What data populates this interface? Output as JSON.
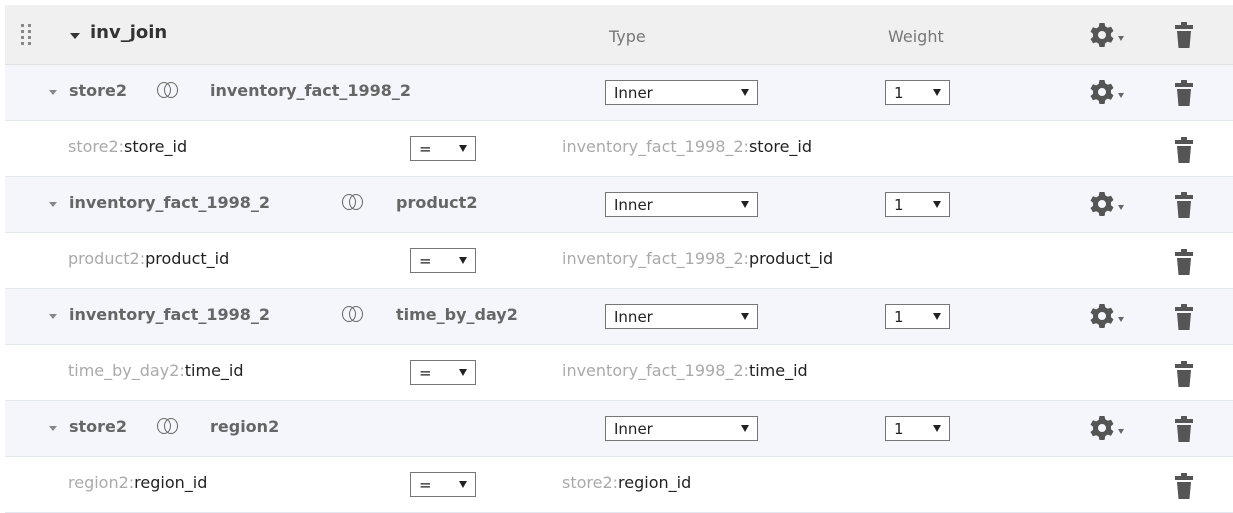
{
  "header": {
    "title": "inv_join",
    "type_label": "Type",
    "weight_label": "Weight",
    "gear_icon": "gear-icon",
    "trash_icon": "trash-icon",
    "drag_icon": "drag-handle-icon"
  },
  "rows": [
    {
      "left": "store2",
      "right": "inventory_fact_1998_2",
      "type": "Inner",
      "weight": "1",
      "cond": {
        "l_table": "store2:",
        "l_col": "store_id",
        "op": "=",
        "r_table": "inventory_fact_1998_2:",
        "r_col": "store_id"
      }
    },
    {
      "left": "inventory_fact_1998_2",
      "right": "product2",
      "type": "Inner",
      "weight": "1",
      "cond": {
        "l_table": "product2:",
        "l_col": "product_id",
        "op": "=",
        "r_table": "inventory_fact_1998_2:",
        "r_col": "product_id"
      }
    },
    {
      "left": "inventory_fact_1998_2",
      "right": "time_by_day2",
      "type": "Inner",
      "weight": "1",
      "cond": {
        "l_table": "time_by_day2:",
        "l_col": "time_id",
        "op": "=",
        "r_table": "inventory_fact_1998_2:",
        "r_col": "time_id"
      }
    },
    {
      "left": "store2",
      "right": "region2",
      "type": "Inner",
      "weight": "1",
      "cond": {
        "l_table": "region2:",
        "l_col": "region_id",
        "op": "=",
        "r_table": "store2:",
        "r_col": "region_id"
      }
    }
  ],
  "colors": {
    "header_bg": "#f0f0f0",
    "join_row_bg": "#f5f6fb",
    "icon": "#555555"
  }
}
